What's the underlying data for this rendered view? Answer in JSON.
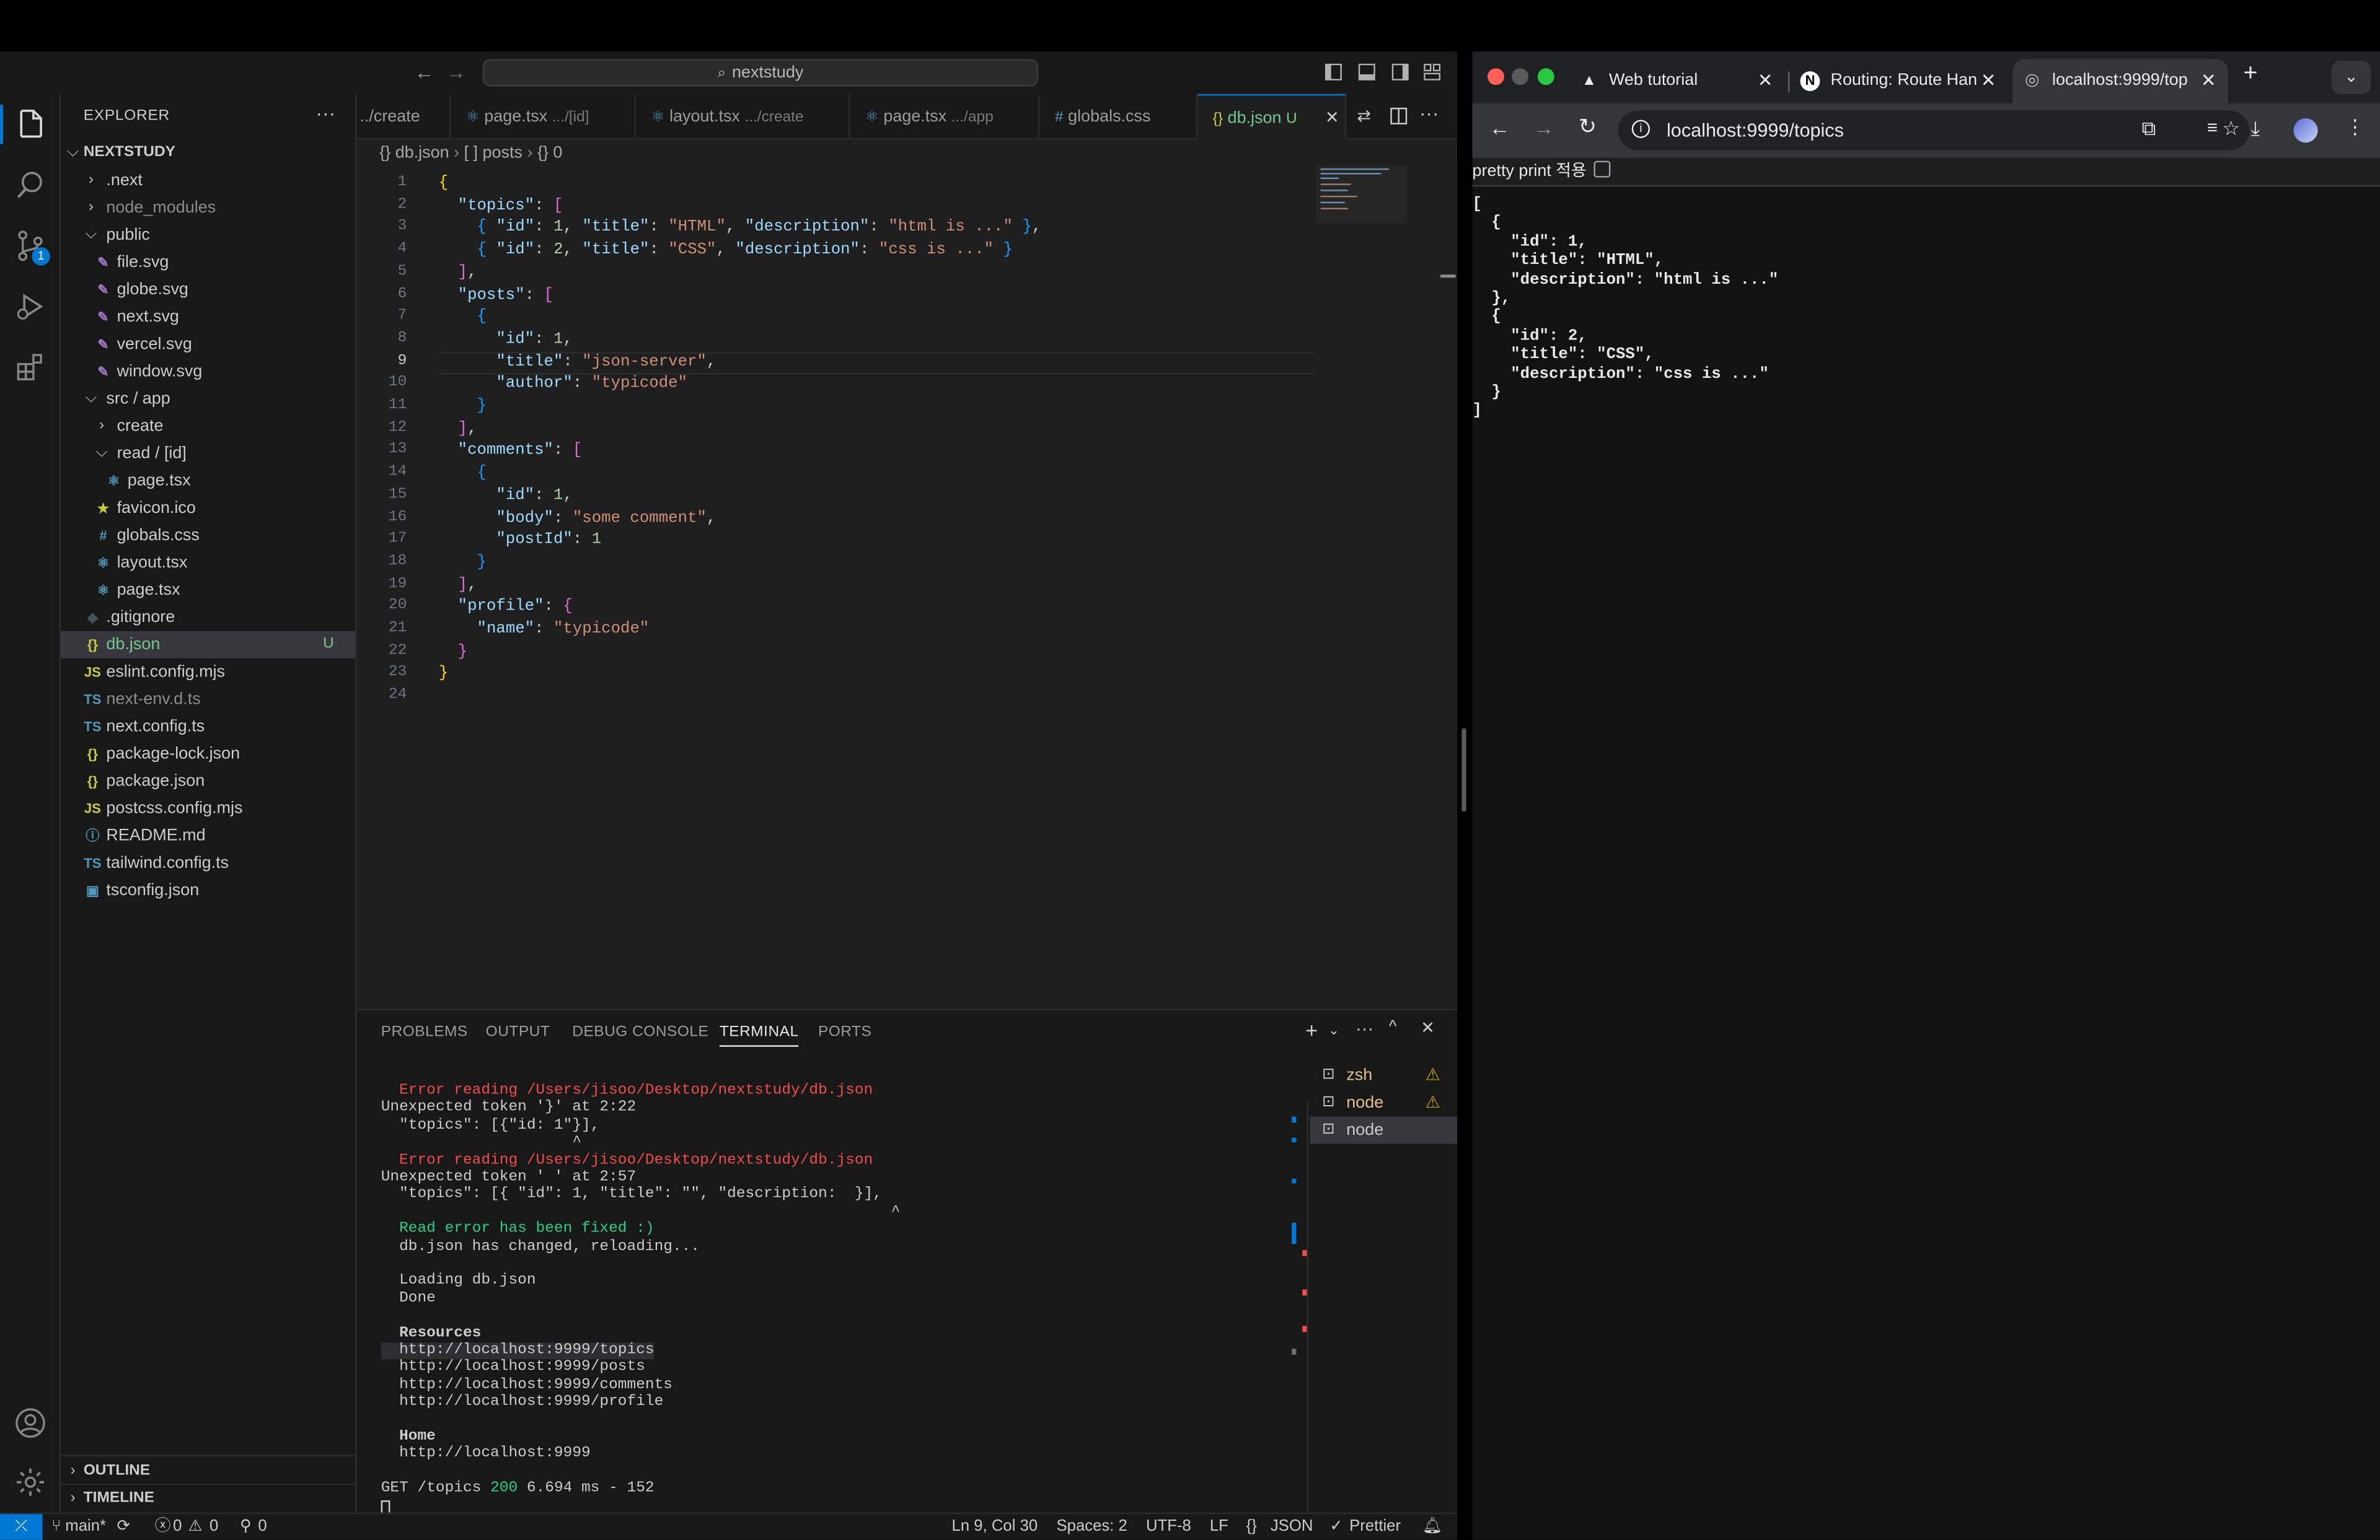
{
  "vscode": {
    "search_text": "nextstudy",
    "explorer": {
      "title": "EXPLORER",
      "workspace": "NEXTSTUDY",
      "outline": "OUTLINE",
      "timeline": "TIMELINE",
      "tree": [
        {
          "label": ".next",
          "kind": "folder",
          "depth": 1,
          "open": false,
          "color": "#cccccc"
        },
        {
          "label": "node_modules",
          "kind": "folder",
          "depth": 1,
          "open": false,
          "color": "#8c8c8c"
        },
        {
          "label": "public",
          "kind": "folder",
          "depth": 1,
          "open": true,
          "color": "#cccccc"
        },
        {
          "label": "file.svg",
          "kind": "svg",
          "depth": 2,
          "color": "#cccccc"
        },
        {
          "label": "globe.svg",
          "kind": "svg",
          "depth": 2,
          "color": "#cccccc"
        },
        {
          "label": "next.svg",
          "kind": "svg",
          "depth": 2,
          "color": "#cccccc"
        },
        {
          "label": "vercel.svg",
          "kind": "svg",
          "depth": 2,
          "color": "#cccccc"
        },
        {
          "label": "window.svg",
          "kind": "svg",
          "depth": 2,
          "color": "#cccccc"
        },
        {
          "label": "src / app",
          "kind": "folder",
          "depth": 1,
          "open": true,
          "color": "#cccccc"
        },
        {
          "label": "create",
          "kind": "folder",
          "depth": 2,
          "open": false,
          "color": "#cccccc"
        },
        {
          "label": "read / [id]",
          "kind": "folder",
          "depth": 2,
          "open": true,
          "color": "#cccccc"
        },
        {
          "label": "page.tsx",
          "kind": "react",
          "depth": 3,
          "color": "#cccccc"
        },
        {
          "label": "favicon.ico",
          "kind": "star",
          "depth": 2,
          "color": "#cccccc"
        },
        {
          "label": "globals.css",
          "kind": "css",
          "depth": 2,
          "color": "#cccccc"
        },
        {
          "label": "layout.tsx",
          "kind": "react",
          "depth": 2,
          "color": "#cccccc"
        },
        {
          "label": "page.tsx",
          "kind": "react",
          "depth": 2,
          "color": "#cccccc"
        },
        {
          "label": ".gitignore",
          "kind": "git",
          "depth": 1,
          "color": "#cccccc"
        },
        {
          "label": "db.json",
          "kind": "json",
          "depth": 1,
          "color": "#73c991",
          "selected": true,
          "badge": "U"
        },
        {
          "label": "eslint.config.mjs",
          "kind": "js",
          "depth": 1,
          "color": "#cccccc"
        },
        {
          "label": "next-env.d.ts",
          "kind": "ts",
          "depth": 1,
          "color": "#8c8c8c"
        },
        {
          "label": "next.config.ts",
          "kind": "ts",
          "depth": 1,
          "color": "#cccccc"
        },
        {
          "label": "package-lock.json",
          "kind": "json",
          "depth": 1,
          "color": "#cccccc"
        },
        {
          "label": "package.json",
          "kind": "json",
          "depth": 1,
          "color": "#cccccc"
        },
        {
          "label": "postcss.config.mjs",
          "kind": "js",
          "depth": 1,
          "color": "#cccccc"
        },
        {
          "label": "README.md",
          "kind": "info",
          "depth": 1,
          "color": "#cccccc"
        },
        {
          "label": "tailwind.config.ts",
          "kind": "ts",
          "depth": 1,
          "color": "#cccccc"
        },
        {
          "label": "tsconfig.json",
          "kind": "tsconfig",
          "depth": 1,
          "color": "#cccccc"
        }
      ]
    },
    "scm_badge": "1",
    "tabs": [
      {
        "label": "../create",
        "path": ""
      },
      {
        "label": "page.tsx",
        "path": ".../[id]"
      },
      {
        "label": "layout.tsx",
        "path": ".../create"
      },
      {
        "label": "page.tsx",
        "path": ".../app"
      },
      {
        "label": "globals.css",
        "path": ""
      },
      {
        "label": "db.json",
        "path": "U",
        "active": true
      }
    ],
    "breadcrumb": [
      "{} db.json",
      "[ ] posts",
      "{} 0"
    ],
    "code_lines": [
      "{",
      "  \"topics\": [",
      "    { \"id\": 1, \"title\": \"HTML\", \"description\": \"html is ...\" },",
      "    { \"id\": 2, \"title\": \"CSS\", \"description\": \"css is ...\" }",
      "  ],",
      "  \"posts\": [",
      "    {",
      "      \"id\": 1,",
      "      \"title\": \"json-server\",",
      "      \"author\": \"typicode\"",
      "    }",
      "  ],",
      "  \"comments\": [",
      "    {",
      "      \"id\": 1,",
      "      \"body\": \"some comment\",",
      "      \"postId\": 1",
      "    }",
      "  ],",
      "  \"profile\": {",
      "    \"name\": \"typicode\"",
      "  }",
      "}",
      ""
    ],
    "current_line": 9,
    "panel": {
      "tabs": [
        "PROBLEMS",
        "OUTPUT",
        "DEBUG CONSOLE",
        "TERMINAL",
        "PORTS"
      ],
      "active_tab": "TERMINAL",
      "terminals": [
        {
          "label": "zsh",
          "warn": true
        },
        {
          "label": "node",
          "warn": true
        },
        {
          "label": "node",
          "warn": false,
          "selected": true
        }
      ],
      "lines": [
        {
          "t": "  Error reading /Users/jisoo/Desktop/nextstudy/db.json",
          "c": "red"
        },
        {
          "t": "Unexpected token '}' at 2:22",
          "c": ""
        },
        {
          "t": "  \"topics\": [{\"id: 1\"}],",
          "c": ""
        },
        {
          "t": "                     ^",
          "c": ""
        },
        {
          "t": "  Error reading /Users/jisoo/Desktop/nextstudy/db.json",
          "c": "red"
        },
        {
          "t": "Unexpected token ' ' at 2:57",
          "c": ""
        },
        {
          "t": "  \"topics\": [{ \"id\": 1, \"title\": \"\", \"description:  }],",
          "c": ""
        },
        {
          "t": "                                                        ^",
          "c": ""
        },
        {
          "t": "  Read error has been fixed :)",
          "c": "green"
        },
        {
          "t": "  db.json has changed, reloading...",
          "c": ""
        },
        {
          "t": "",
          "c": ""
        },
        {
          "t": "  Loading db.json",
          "c": ""
        },
        {
          "t": "  Done",
          "c": ""
        },
        {
          "t": "",
          "c": ""
        },
        {
          "t": "  Resources",
          "c": "bold"
        },
        {
          "t": "  http://localhost:9999/topics",
          "c": "hl"
        },
        {
          "t": "  http://localhost:9999/posts",
          "c": ""
        },
        {
          "t": "  http://localhost:9999/comments",
          "c": ""
        },
        {
          "t": "  http://localhost:9999/profile",
          "c": ""
        },
        {
          "t": "",
          "c": ""
        },
        {
          "t": "  Home",
          "c": "bold"
        },
        {
          "t": "  http://localhost:9999",
          "c": ""
        },
        {
          "t": "",
          "c": ""
        },
        {
          "t": "GET /topics 200 6.694 ms - 152",
          "c": "get"
        }
      ]
    },
    "status": {
      "branch": "main*",
      "errors": "0",
      "warnings": "0",
      "ports": "0",
      "position": "Ln 9, Col 30",
      "spaces": "Spaces: 2",
      "encoding": "UTF-8",
      "eol": "LF",
      "language": "JSON",
      "formatter": "Prettier"
    }
  },
  "chrome": {
    "tabs": [
      {
        "label": "Web tutorial"
      },
      {
        "label": "Routing: Route Han"
      },
      {
        "label": "localhost:9999/top",
        "active": true
      }
    ],
    "url": "localhost:9999/topics",
    "pretty_print_label": "pretty print 적용",
    "json_text": "[\n  {\n    \"id\": 1,\n    \"title\": \"HTML\",\n    \"description\": \"html is ...\"\n  },\n  {\n    \"id\": 2,\n    \"title\": \"CSS\",\n    \"description\": \"css is ...\"\n  }\n]"
  },
  "colors": {
    "accent": "#0078d4",
    "untracked": "#73c991",
    "error": "#f14c4c",
    "success": "#23d18b"
  }
}
